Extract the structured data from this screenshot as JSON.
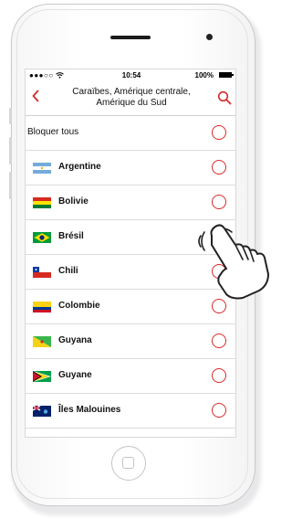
{
  "status_bar": {
    "signal": "●●●○○",
    "wifi_icon": "wifi-icon",
    "time": "10:54",
    "battery_percent": "100%",
    "battery_level": 1.0
  },
  "nav": {
    "back_label": "‹",
    "title_line1": "Caraïbes, Amérique centrale,",
    "title_line2": "Amérique du Sud",
    "search_icon": "search-icon"
  },
  "block_all": {
    "label": "Bloquer tous",
    "checked": false
  },
  "countries": [
    {
      "name": "Argentine",
      "flag": "flag-argentina",
      "checked": false
    },
    {
      "name": "Bolivie",
      "flag": "flag-bolivia",
      "checked": false
    },
    {
      "name": "Brésil",
      "flag": "flag-brazil",
      "checked": true
    },
    {
      "name": "Chili",
      "flag": "flag-chile",
      "checked": false
    },
    {
      "name": "Colombie",
      "flag": "flag-colombia",
      "checked": false
    },
    {
      "name": "Guyana",
      "flag": "flag-guyana",
      "checked": false
    },
    {
      "name": "Guyane",
      "flag": "flag-french-guiana",
      "checked": false
    },
    {
      "name": "Îles Malouines",
      "flag": "flag-falkland-islands",
      "checked": false
    }
  ],
  "colors": {
    "accent": "#d62a2a",
    "divider": "#dcdcdc"
  }
}
